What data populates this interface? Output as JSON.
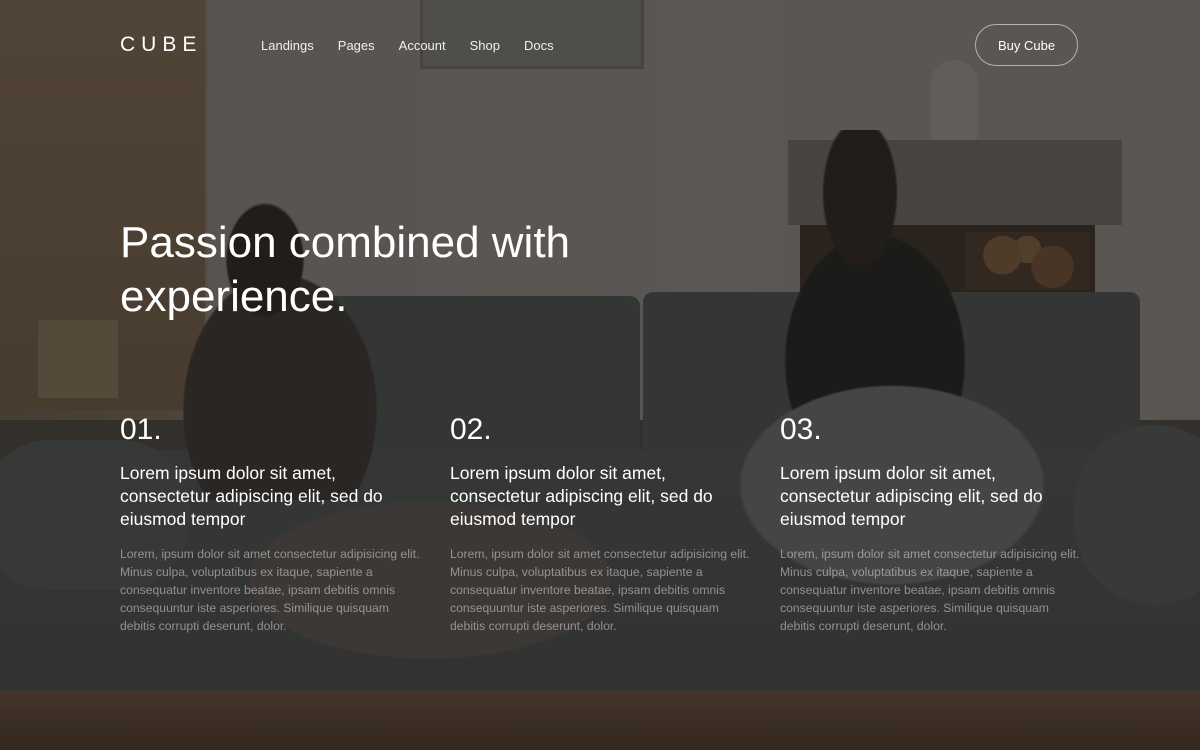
{
  "header": {
    "logo": "CUBE",
    "nav": [
      "Landings",
      "Pages",
      "Account",
      "Shop",
      "Docs"
    ],
    "cta_label": "Buy Cube"
  },
  "hero": {
    "title_line1": "Passion combined with",
    "title_line2": "experience."
  },
  "features": [
    {
      "number": "01.",
      "heading": "Lorem ipsum dolor sit amet, consectetur adipiscing elit, sed do eiusmod tempor",
      "description": "Lorem, ipsum dolor sit amet consectetur adipisicing elit. Minus culpa, voluptatibus ex itaque, sapiente a consequatur inventore beatae, ipsam debitis omnis consequuntur iste asperiores. Similique quisquam debitis corrupti deserunt, dolor."
    },
    {
      "number": "02.",
      "heading": "Lorem ipsum dolor sit amet, consectetur adipiscing elit, sed do eiusmod tempor",
      "description": "Lorem, ipsum dolor sit amet consectetur adipisicing elit. Minus culpa, voluptatibus ex itaque, sapiente a consequatur inventore beatae, ipsam debitis omnis consequuntur iste asperiores. Similique quisquam debitis corrupti deserunt, dolor."
    },
    {
      "number": "03.",
      "heading": "Lorem ipsum dolor sit amet, consectetur adipiscing elit, sed do eiusmod tempor",
      "description": "Lorem, ipsum dolor sit amet consectetur adipisicing elit. Minus culpa, voluptatibus ex itaque, sapiente a consequatur inventore beatae, ipsam debitis omnis consequuntur iste asperiores. Similique quisquam debitis corrupti deserunt, dolor."
    }
  ]
}
